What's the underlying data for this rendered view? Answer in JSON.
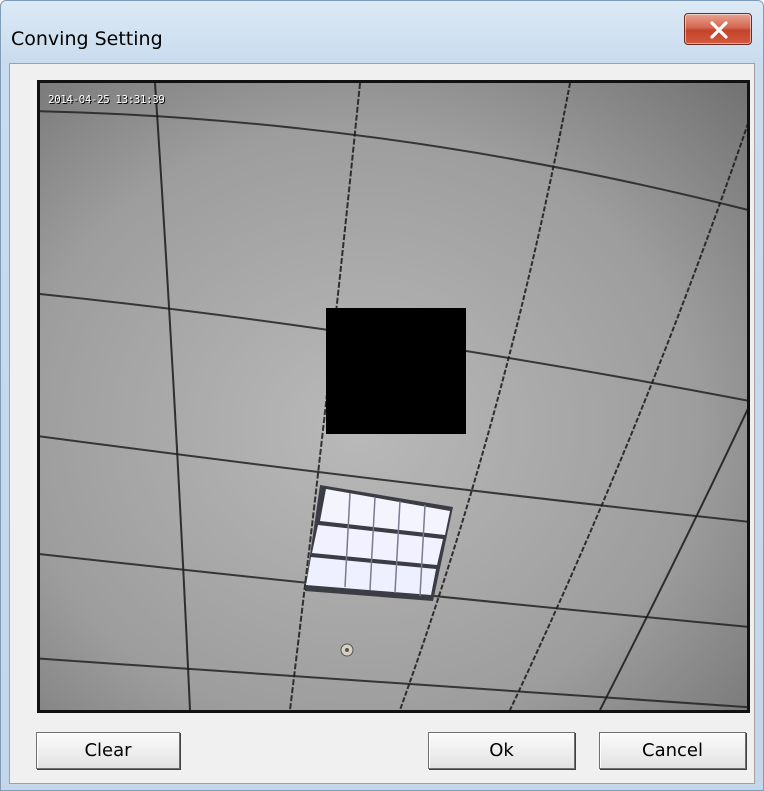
{
  "window": {
    "title": "Conving Setting",
    "close_icon": "close-x-icon"
  },
  "video": {
    "timestamp": "2014-04-25 13:31:39",
    "privacy_mask_color": "#000000"
  },
  "buttons": {
    "clear": "Clear",
    "ok": "Ok",
    "cancel": "Cancel"
  },
  "colors": {
    "close_button": "#c3432b",
    "client_bg": "#f0f0f0",
    "titlebar": "#dce9f5"
  }
}
